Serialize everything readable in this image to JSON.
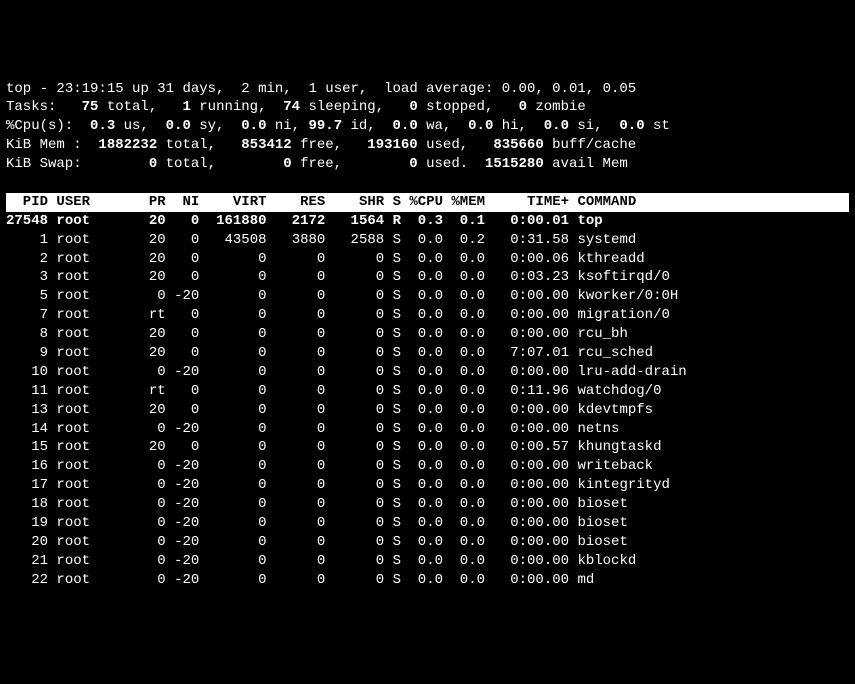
{
  "summary": {
    "line1_pre": "top - ",
    "time": "23:19:15",
    "up_pre": " up ",
    "uptime": "31 days,  2 min",
    "users_pre": ",  ",
    "users": "1 user",
    "load_pre": ",  load average: ",
    "load": "0.00, 0.01, 0.05",
    "tasks_label": "Tasks: ",
    "tasks_total": "  75 ",
    "tasks_total_l": "total,   ",
    "tasks_run": "1 ",
    "tasks_run_l": "running,  ",
    "tasks_sleep": "74 ",
    "tasks_sleep_l": "sleeping,   ",
    "tasks_stop": "0 ",
    "tasks_stop_l": "stopped,   ",
    "tasks_zomb": "0 ",
    "tasks_zomb_l": "zombie",
    "cpu_label": "%Cpu(s):  ",
    "cpu_us": "0.3 ",
    "cpu_us_l": "us,  ",
    "cpu_sy": "0.0 ",
    "cpu_sy_l": "sy,  ",
    "cpu_ni": "0.0 ",
    "cpu_ni_l": "ni, ",
    "cpu_id": "99.7 ",
    "cpu_id_l": "id,  ",
    "cpu_wa": "0.0 ",
    "cpu_wa_l": "wa,  ",
    "cpu_hi": "0.0 ",
    "cpu_hi_l": "hi,  ",
    "cpu_si": "0.0 ",
    "cpu_si_l": "si,  ",
    "cpu_st": "0.0 ",
    "cpu_st_l": "st",
    "mem_label": "KiB Mem : ",
    "mem_total": " 1882232 ",
    "mem_total_l": "total,   ",
    "mem_free": "853412 ",
    "mem_free_l": "free,   ",
    "mem_used": "193160 ",
    "mem_used_l": "used,   ",
    "mem_buff": "835660 ",
    "mem_buff_l": "buff/cache",
    "swp_label": "KiB Swap:        ",
    "swp_total": "0 ",
    "swp_total_l": "total,        ",
    "swp_free": "0 ",
    "swp_free_l": "free,        ",
    "swp_used": "0 ",
    "swp_used_l": "used.  ",
    "swp_avail": "1515280 ",
    "swp_avail_l": "avail Mem "
  },
  "columns": {
    "pid": "  PID",
    "user": "USER     ",
    "pr": " PR",
    "ni": " NI",
    "virt": "   VIRT",
    "res": "   RES",
    "shr": "   SHR",
    "s": "S",
    "cpu": "%CPU",
    "mem": "%MEM",
    "time": "    TIME+",
    "cmd": "COMMAND           "
  },
  "rows": [
    {
      "pid": "27548",
      "user": "root     ",
      "pr": " 20",
      "ni": "  0",
      "virt": " 161880",
      "res": "  2172",
      "shr": "  1564",
      "s": "R",
      "cpu": " 0.3",
      "mem": " 0.1",
      "time": "  0:00.01",
      "cmd": "top               ",
      "hl": true
    },
    {
      "pid": "    1",
      "user": "root     ",
      "pr": " 20",
      "ni": "  0",
      "virt": "  43508",
      "res": "  3880",
      "shr": "  2588",
      "s": "S",
      "cpu": " 0.0",
      "mem": " 0.2",
      "time": "  0:31.58",
      "cmd": "systemd           "
    },
    {
      "pid": "    2",
      "user": "root     ",
      "pr": " 20",
      "ni": "  0",
      "virt": "      0",
      "res": "     0",
      "shr": "     0",
      "s": "S",
      "cpu": " 0.0",
      "mem": " 0.0",
      "time": "  0:00.06",
      "cmd": "kthreadd          "
    },
    {
      "pid": "    3",
      "user": "root     ",
      "pr": " 20",
      "ni": "  0",
      "virt": "      0",
      "res": "     0",
      "shr": "     0",
      "s": "S",
      "cpu": " 0.0",
      "mem": " 0.0",
      "time": "  0:03.23",
      "cmd": "ksoftirqd/0       "
    },
    {
      "pid": "    5",
      "user": "root     ",
      "pr": "  0",
      "ni": "-20",
      "virt": "      0",
      "res": "     0",
      "shr": "     0",
      "s": "S",
      "cpu": " 0.0",
      "mem": " 0.0",
      "time": "  0:00.00",
      "cmd": "kworker/0:0H      "
    },
    {
      "pid": "    7",
      "user": "root     ",
      "pr": " rt",
      "ni": "  0",
      "virt": "      0",
      "res": "     0",
      "shr": "     0",
      "s": "S",
      "cpu": " 0.0",
      "mem": " 0.0",
      "time": "  0:00.00",
      "cmd": "migration/0       "
    },
    {
      "pid": "    8",
      "user": "root     ",
      "pr": " 20",
      "ni": "  0",
      "virt": "      0",
      "res": "     0",
      "shr": "     0",
      "s": "S",
      "cpu": " 0.0",
      "mem": " 0.0",
      "time": "  0:00.00",
      "cmd": "rcu_bh            "
    },
    {
      "pid": "    9",
      "user": "root     ",
      "pr": " 20",
      "ni": "  0",
      "virt": "      0",
      "res": "     0",
      "shr": "     0",
      "s": "S",
      "cpu": " 0.0",
      "mem": " 0.0",
      "time": "  7:07.01",
      "cmd": "rcu_sched         "
    },
    {
      "pid": "   10",
      "user": "root     ",
      "pr": "  0",
      "ni": "-20",
      "virt": "      0",
      "res": "     0",
      "shr": "     0",
      "s": "S",
      "cpu": " 0.0",
      "mem": " 0.0",
      "time": "  0:00.00",
      "cmd": "lru-add-drain     "
    },
    {
      "pid": "   11",
      "user": "root     ",
      "pr": " rt",
      "ni": "  0",
      "virt": "      0",
      "res": "     0",
      "shr": "     0",
      "s": "S",
      "cpu": " 0.0",
      "mem": " 0.0",
      "time": "  0:11.96",
      "cmd": "watchdog/0        "
    },
    {
      "pid": "   13",
      "user": "root     ",
      "pr": " 20",
      "ni": "  0",
      "virt": "      0",
      "res": "     0",
      "shr": "     0",
      "s": "S",
      "cpu": " 0.0",
      "mem": " 0.0",
      "time": "  0:00.00",
      "cmd": "kdevtmpfs         "
    },
    {
      "pid": "   14",
      "user": "root     ",
      "pr": "  0",
      "ni": "-20",
      "virt": "      0",
      "res": "     0",
      "shr": "     0",
      "s": "S",
      "cpu": " 0.0",
      "mem": " 0.0",
      "time": "  0:00.00",
      "cmd": "netns             "
    },
    {
      "pid": "   15",
      "user": "root     ",
      "pr": " 20",
      "ni": "  0",
      "virt": "      0",
      "res": "     0",
      "shr": "     0",
      "s": "S",
      "cpu": " 0.0",
      "mem": " 0.0",
      "time": "  0:00.57",
      "cmd": "khungtaskd        "
    },
    {
      "pid": "   16",
      "user": "root     ",
      "pr": "  0",
      "ni": "-20",
      "virt": "      0",
      "res": "     0",
      "shr": "     0",
      "s": "S",
      "cpu": " 0.0",
      "mem": " 0.0",
      "time": "  0:00.00",
      "cmd": "writeback         "
    },
    {
      "pid": "   17",
      "user": "root     ",
      "pr": "  0",
      "ni": "-20",
      "virt": "      0",
      "res": "     0",
      "shr": "     0",
      "s": "S",
      "cpu": " 0.0",
      "mem": " 0.0",
      "time": "  0:00.00",
      "cmd": "kintegrityd       "
    },
    {
      "pid": "   18",
      "user": "root     ",
      "pr": "  0",
      "ni": "-20",
      "virt": "      0",
      "res": "     0",
      "shr": "     0",
      "s": "S",
      "cpu": " 0.0",
      "mem": " 0.0",
      "time": "  0:00.00",
      "cmd": "bioset            "
    },
    {
      "pid": "   19",
      "user": "root     ",
      "pr": "  0",
      "ni": "-20",
      "virt": "      0",
      "res": "     0",
      "shr": "     0",
      "s": "S",
      "cpu": " 0.0",
      "mem": " 0.0",
      "time": "  0:00.00",
      "cmd": "bioset            "
    },
    {
      "pid": "   20",
      "user": "root     ",
      "pr": "  0",
      "ni": "-20",
      "virt": "      0",
      "res": "     0",
      "shr": "     0",
      "s": "S",
      "cpu": " 0.0",
      "mem": " 0.0",
      "time": "  0:00.00",
      "cmd": "bioset            "
    },
    {
      "pid": "   21",
      "user": "root     ",
      "pr": "  0",
      "ni": "-20",
      "virt": "      0",
      "res": "     0",
      "shr": "     0",
      "s": "S",
      "cpu": " 0.0",
      "mem": " 0.0",
      "time": "  0:00.00",
      "cmd": "kblockd           "
    },
    {
      "pid": "   22",
      "user": "root     ",
      "pr": "  0",
      "ni": "-20",
      "virt": "      0",
      "res": "     0",
      "shr": "     0",
      "s": "S",
      "cpu": " 0.0",
      "mem": " 0.0",
      "time": "  0:00.00",
      "cmd": "md                "
    }
  ]
}
